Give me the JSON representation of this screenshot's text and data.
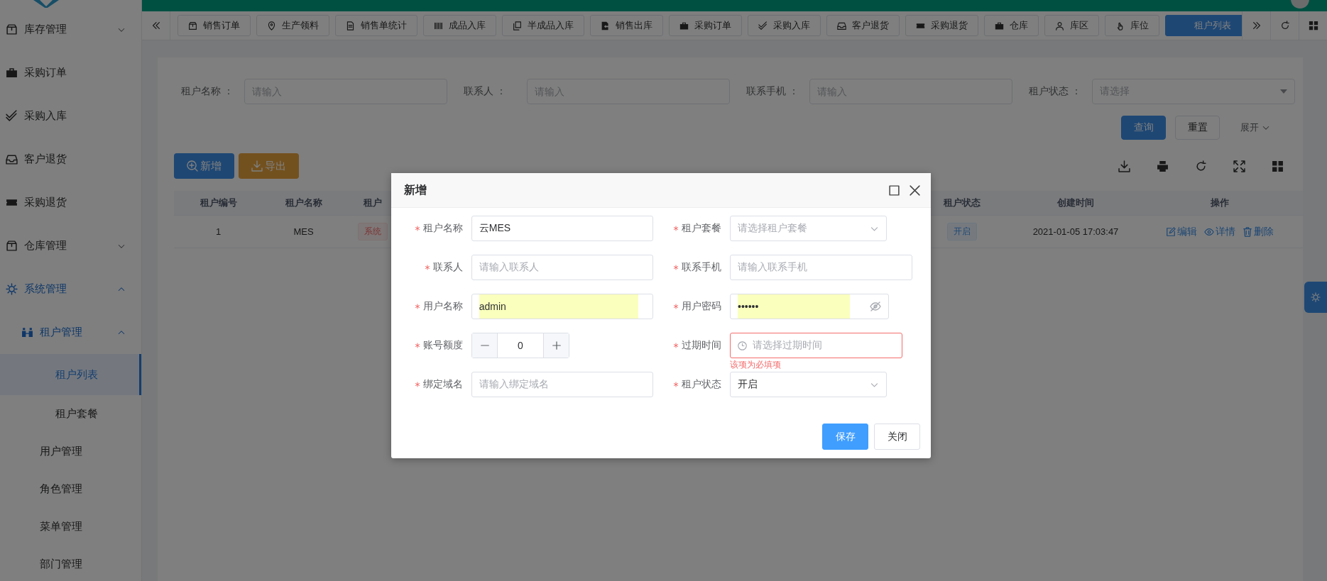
{
  "header": {
    "tabs": [
      {
        "label": "销售订单",
        "selected": false
      },
      {
        "label": "生产领料",
        "selected": false
      },
      {
        "label": "销售单统计",
        "selected": false
      },
      {
        "label": "成品入库",
        "selected": false
      },
      {
        "label": "半成品入库",
        "selected": false
      },
      {
        "label": "销售出库",
        "selected": false
      },
      {
        "label": "采购订单",
        "selected": false
      },
      {
        "label": "采购入库",
        "selected": false
      },
      {
        "label": "客户退货",
        "selected": false
      },
      {
        "label": "采购退货",
        "selected": false
      },
      {
        "label": "仓库",
        "selected": false
      },
      {
        "label": "库区",
        "selected": false
      },
      {
        "label": "库位",
        "selected": false
      },
      {
        "label": "租户列表",
        "selected": true
      }
    ]
  },
  "sidebar": {
    "items": [
      {
        "label": "库存管理",
        "expanded": false
      },
      {
        "label": "采购订单",
        "selected": false
      },
      {
        "label": "采购入库",
        "selected": false
      },
      {
        "label": "客户退货",
        "selected": false
      },
      {
        "label": "采购退货",
        "selected": false
      },
      {
        "label": "仓库管理",
        "expanded": false
      },
      {
        "label": "系统管理",
        "expanded": true,
        "children": [
          {
            "label": "租户管理",
            "expanded": true,
            "children": [
              {
                "label": "租户列表",
                "selected": true
              },
              {
                "label": "租户套餐",
                "selected": false
              }
            ]
          },
          {
            "label": "用户管理",
            "selected": false
          },
          {
            "label": "角色管理",
            "selected": false
          },
          {
            "label": "菜单管理",
            "selected": false
          },
          {
            "label": "部门管理",
            "selected": false
          }
        ]
      }
    ]
  },
  "filters": [
    {
      "label": "租户名称 ：",
      "kind": "input",
      "placeholder": "请输入"
    },
    {
      "label": "联系人 ：",
      "kind": "input",
      "placeholder": "请输入"
    },
    {
      "label": "联系手机 ：",
      "kind": "input",
      "placeholder": "请输入"
    },
    {
      "label": "租户状态 ：",
      "kind": "select",
      "placeholder": "请选择"
    }
  ],
  "search_buttons": [
    {
      "label": "查询",
      "kind": "primary"
    },
    {
      "label": "重置",
      "kind": "default"
    }
  ],
  "expand_toggle": {
    "label": "展开",
    "expanded": false
  },
  "actions": [
    {
      "label": "新增",
      "kind": "add"
    },
    {
      "label": "导出",
      "kind": "export"
    }
  ],
  "table": {
    "columns": [
      "租户编号",
      "租户名称",
      "租户",
      "租户状态",
      "创建时间",
      "操作"
    ],
    "rows": [
      {
        "tenant_id": "1",
        "tenant_name": "MES",
        "column_3": "系统",
        "status": "开启",
        "created_at": "2021-01-05 17:03:47",
        "actions": [
          "编辑",
          "详情",
          "删除"
        ]
      }
    ]
  },
  "dialog": {
    "title": "新增",
    "fields": [
      {
        "label": "租户名称",
        "kind": "text",
        "required": true,
        "value": "云MES",
        "autofilled": false
      },
      {
        "label": "租户套餐",
        "kind": "select",
        "required": true,
        "placeholder": "请选择租户套餐"
      },
      {
        "label": "联系人",
        "kind": "text",
        "required": true,
        "placeholder": "请输入联系人"
      },
      {
        "label": "联系手机",
        "kind": "text",
        "required": true,
        "placeholder": "请输入联系手机"
      },
      {
        "label": "用户名称",
        "kind": "text",
        "required": true,
        "value": "admin",
        "autofilled": true
      },
      {
        "label": "用户密码",
        "kind": "password",
        "required": true,
        "value": "••••••",
        "autofilled": true
      },
      {
        "label": "账号额度",
        "kind": "number",
        "required": true,
        "value": "0"
      },
      {
        "label": "过期时间",
        "kind": "date",
        "required": true,
        "placeholder": "请选择过期时间",
        "error": "该项为必填项"
      },
      {
        "label": "绑定域名",
        "kind": "text",
        "required": true,
        "placeholder": "请输入绑定域名"
      },
      {
        "label": "租户状态",
        "kind": "select",
        "required": true,
        "value": "开启"
      }
    ],
    "buttons": [
      {
        "label": "保存",
        "kind": "primary"
      },
      {
        "label": "关闭",
        "kind": "default"
      }
    ]
  }
}
